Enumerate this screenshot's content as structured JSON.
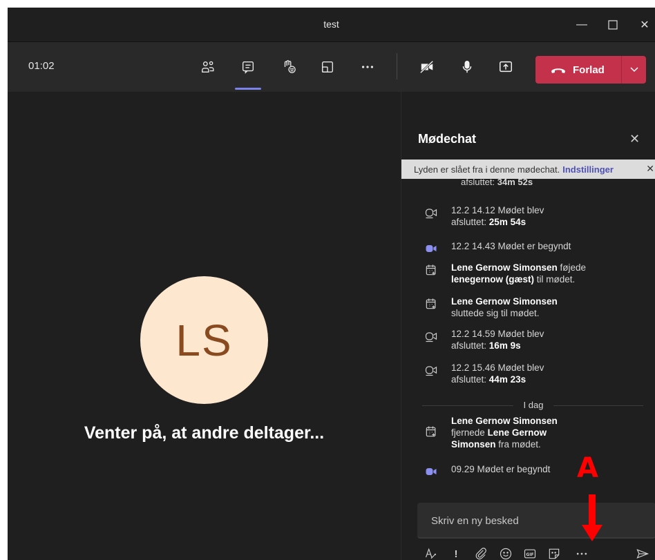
{
  "window": {
    "title": "test",
    "minimize_icon": "minimize-icon",
    "maximize_icon": "maximize-icon",
    "close_icon": "close-icon"
  },
  "toolbar": {
    "timer": "01:02",
    "leave_label": "Forlad",
    "buttons": [
      "people-icon",
      "chat-icon",
      "raise-hand-icon",
      "rooms-icon",
      "more-icon",
      "camera-off-icon",
      "microphone-icon",
      "share-icon"
    ]
  },
  "stage": {
    "initials": "LS",
    "waiting_text": "Venter på, at andre deltager..."
  },
  "chat": {
    "title": "Mødechat",
    "banner": {
      "text": "Lyden er slået fra i denne mødechat.",
      "link": "Indstillinger"
    },
    "partial_text_a": "afsluttet:",
    "partial_text_b": "34m 52s",
    "messages": [
      {
        "icon": "meeting-ended-icon",
        "line1": "12.2 14.12   Mødet blev",
        "line2_prefix": "afsluttet:",
        "line2_bold": "25m 54s"
      },
      {
        "icon": "meeting-started-icon",
        "text": "12.2 14.43   Mødet er begyndt"
      },
      {
        "icon": "calendar-add-icon",
        "bold1": "Lene Gernow Simonsen",
        "text1": " føjede",
        "bold2": "lenegernow (gæst)",
        "text2": " til mødet."
      },
      {
        "icon": "calendar-add-icon",
        "bold1": "Lene Gernow Simonsen",
        "text1": "sluttede sig til mødet."
      },
      {
        "icon": "meeting-ended-icon",
        "line1": "12.2 14.59   Mødet blev",
        "line2_prefix": "afsluttet:",
        "line2_bold": "16m 9s"
      },
      {
        "icon": "meeting-ended-icon",
        "line1": "12.2 15.46   Mødet blev",
        "line2_prefix": "afsluttet:",
        "line2_bold": "44m 23s"
      },
      {
        "icon": "calendar-add-icon",
        "bold1": "Lene Gernow Simonsen",
        "text1": "fjernede",
        "bold2": "Lene Gernow",
        "bold3": "Simonsen",
        "text2": " fra mødet."
      },
      {
        "icon": "meeting-started-icon",
        "text": "09.29   Mødet er begyndt"
      }
    ],
    "divider_label": "I dag",
    "compose_placeholder": "Skriv en ny besked",
    "compose_tools": [
      "format-icon",
      "important-icon",
      "attach-icon",
      "emoji-icon",
      "gif-icon",
      "sticker-icon",
      "more-icon",
      "send-icon"
    ],
    "gif_label": "GIF"
  },
  "annotation": {
    "label": "A",
    "color": "#ff0000"
  },
  "colors": {
    "leave": "#c4314b",
    "accent": "#7b83eb",
    "avatar_bg": "#fde7cf",
    "avatar_text": "#8a4a1f"
  }
}
